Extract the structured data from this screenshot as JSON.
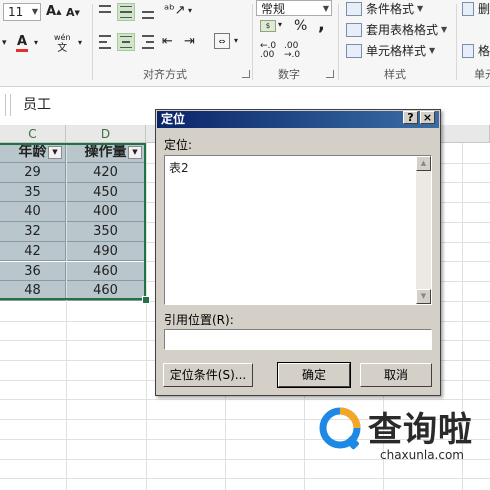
{
  "ribbon": {
    "font_size": "11",
    "grow_font": "A",
    "shrink_font": "A",
    "font_color_label": "A",
    "phonetic_label": "wén",
    "phonetic_char": "文",
    "number_format": "常规",
    "currency_symbol": "%",
    "comma_symbol": ",",
    "groups": {
      "alignment": "对齐方式",
      "number": "数字",
      "styles": "样式",
      "cells_partial": "单元"
    },
    "styles": {
      "conditional_format": "条件格式",
      "format_as_table": "套用表格格式",
      "cell_styles": "单元格样式"
    },
    "right_partial": [
      "删",
      "格"
    ]
  },
  "formula_bar": {
    "value": "员工"
  },
  "grid": {
    "columns": [
      "C",
      "D"
    ],
    "headers": [
      "年龄",
      "操作量"
    ],
    "rows": [
      [
        "29",
        "420"
      ],
      [
        "35",
        "450"
      ],
      [
        "40",
        "400"
      ],
      [
        "32",
        "350"
      ],
      [
        "42",
        "490"
      ],
      [
        "36",
        "460"
      ],
      [
        "48",
        "460"
      ]
    ]
  },
  "dialog": {
    "title": "定位",
    "help_button": "?",
    "close_button": "×",
    "goto_label": "定位:",
    "goto_items": [
      "表2"
    ],
    "reference_label": "引用位置(R):",
    "reference_value": "",
    "special_button": "定位条件(S)...",
    "ok_button": "确定",
    "cancel_button": "取消"
  },
  "watermark": {
    "brand": "查询啦",
    "url": "chaxunla.com"
  },
  "colors": {
    "table_fill": "#b9c7cc",
    "selection": "#217346",
    "dialog_title": "#0a246a",
    "watermark_blue": "#1e88e5",
    "watermark_orange": "#f5a623"
  }
}
